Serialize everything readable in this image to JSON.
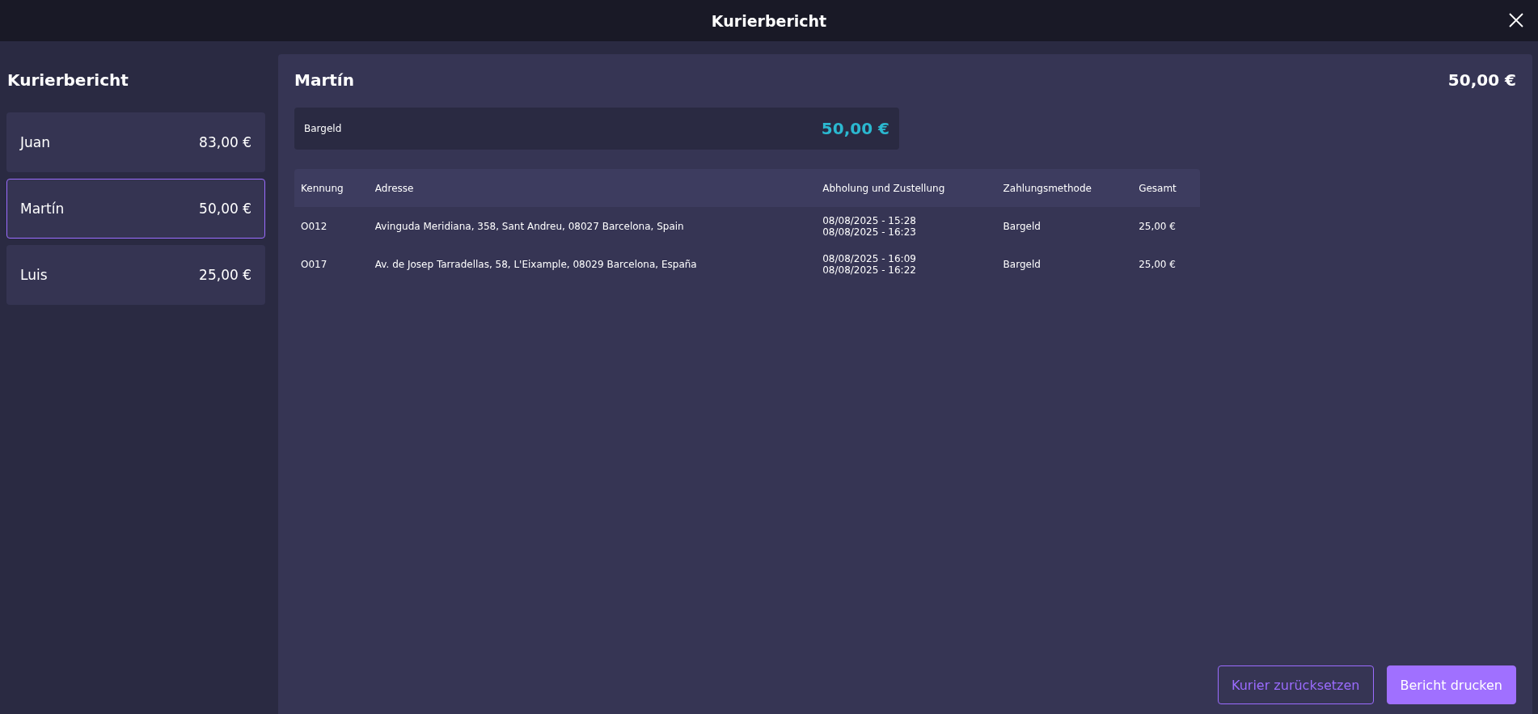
{
  "window": {
    "title": "Kurierbericht"
  },
  "sidebar": {
    "title": "Kurierbericht",
    "couriers": [
      {
        "name": "Juan",
        "total": "83,00 €",
        "selected": false
      },
      {
        "name": "Martín",
        "total": "50,00 €",
        "selected": true
      },
      {
        "name": "Luis",
        "total": "25,00 €",
        "selected": false
      }
    ]
  },
  "detail": {
    "name": "Martín",
    "total": "50,00 €",
    "payments": [
      {
        "method": "Bargeld",
        "amount": "50,00 €"
      }
    ],
    "table": {
      "columns": [
        "Kennung",
        "Adresse",
        "Abholung und Zustellung",
        "Zahlungsmethode",
        "Gesamt"
      ],
      "rows": [
        {
          "id": "O012",
          "address": "Avinguda Meridiana, 358, Sant Andreu, 08027 Barcelona, Spain",
          "pickup": "08/08/2025 - 15:28",
          "delivery": "08/08/2025 - 16:23",
          "payment": "Bargeld",
          "total": "25,00 €"
        },
        {
          "id": "O017",
          "address": "Av. de Josep Tarradellas, 58, L'Eixample, 08029 Barcelona, España",
          "pickup": "08/08/2025 - 16:09",
          "delivery": "08/08/2025 - 16:22",
          "payment": "Bargeld",
          "total": "25,00 €"
        }
      ]
    }
  },
  "buttons": [
    {
      "label": "Kurier zurücksetzen",
      "kind": "outline"
    },
    {
      "label": "Bericht drucken",
      "kind": "primary"
    }
  ]
}
